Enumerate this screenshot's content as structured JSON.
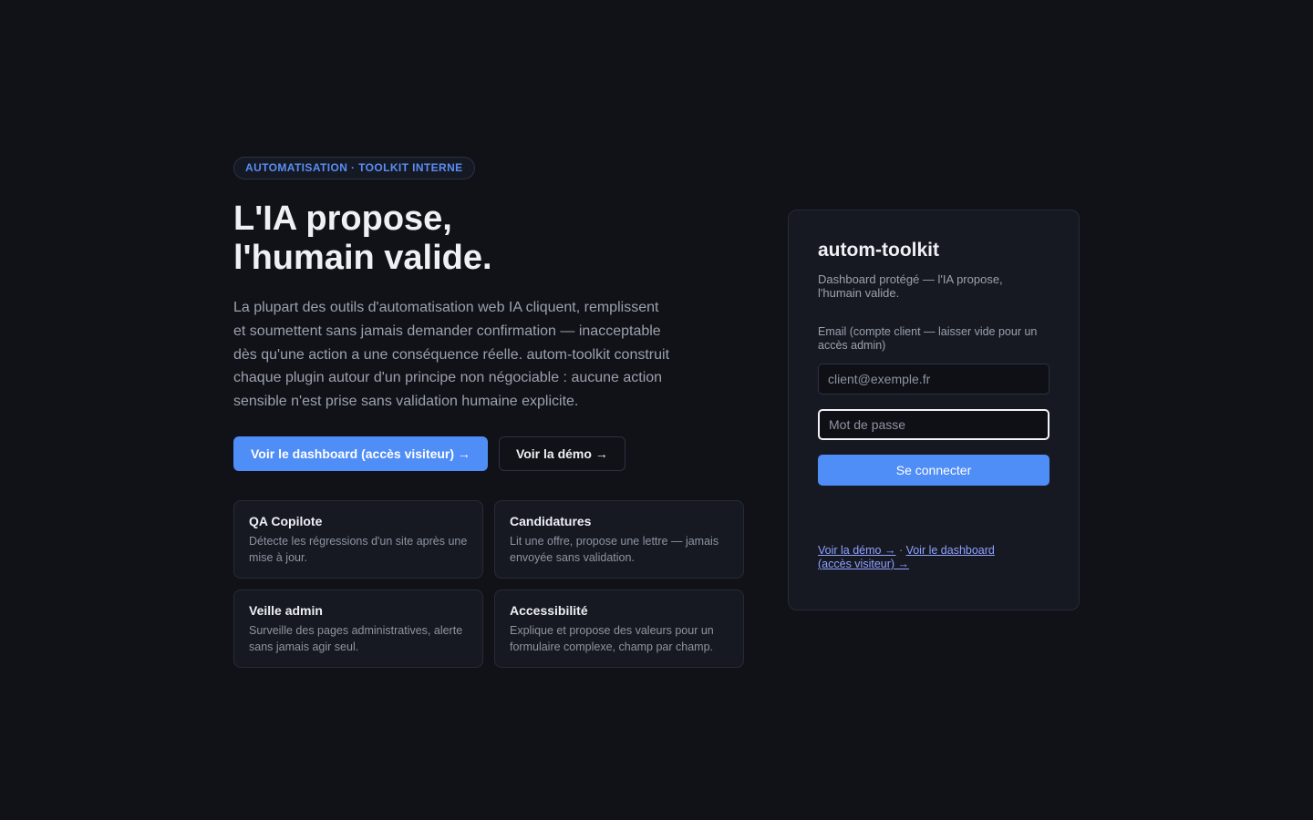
{
  "hero": {
    "eyebrow": "AUTOMATISATION · TOOLKIT INTERNE",
    "headline": "L'IA propose,\nl'humain valide.",
    "intro": "La plupart des outils d'automatisation web IA cliquent, remplissent et soumettent sans jamais demander confirmation — inacceptable dès qu'une action a une conséquence réelle. autom-toolkit construit chaque plugin autour d'un principe non négociable : aucune action sensible n'est prise sans validation humaine explicite.",
    "primary_cta": "Voir le dashboard (accès visiteur) →",
    "secondary_cta": "Voir la démo →"
  },
  "features": [
    {
      "title": "QA Copilote",
      "desc": "Détecte les régressions d'un site après une mise à jour."
    },
    {
      "title": "Candidatures",
      "desc": "Lit une offre, propose une lettre — jamais envoyée sans validation."
    },
    {
      "title": "Veille admin",
      "desc": "Surveille des pages administratives, alerte sans jamais agir seul."
    },
    {
      "title": "Accessibilité",
      "desc": "Explique et propose des valeurs pour un formulaire complexe, champ par champ."
    }
  ],
  "login": {
    "title": "autom-toolkit",
    "subtitle": "Dashboard protégé — l'IA propose, l'humain valide.",
    "email_label": "Email (compte client — laisser vide pour un accès admin)",
    "email_placeholder": "client@exemple.fr",
    "password_placeholder": "Mot de passe",
    "submit_label": "Se connecter",
    "link_demo": "Voir la démo →",
    "link_separator": " · ",
    "link_dashboard": "Voir le dashboard (accès visiteur) →"
  },
  "colors": {
    "background": "#111218",
    "accent": "#4f8df7",
    "link": "#8ea2ff",
    "card": "#161922"
  }
}
